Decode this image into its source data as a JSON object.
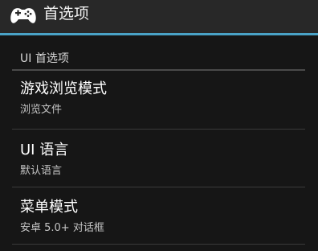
{
  "action_bar": {
    "icon": "gamepad-icon",
    "title": "首选项"
  },
  "category": {
    "title": "UI 首选项"
  },
  "preferences": [
    {
      "title": "游戏浏览模式",
      "summary": "浏览文件"
    },
    {
      "title": "UI 语言",
      "summary": "默认语言"
    },
    {
      "title": "菜单模式",
      "summary": "安卓 5.0+ 对话框"
    }
  ],
  "colors": {
    "accent": "#4aa3c7",
    "action_bar_bg": "#282828",
    "content_bg": "#161616"
  }
}
